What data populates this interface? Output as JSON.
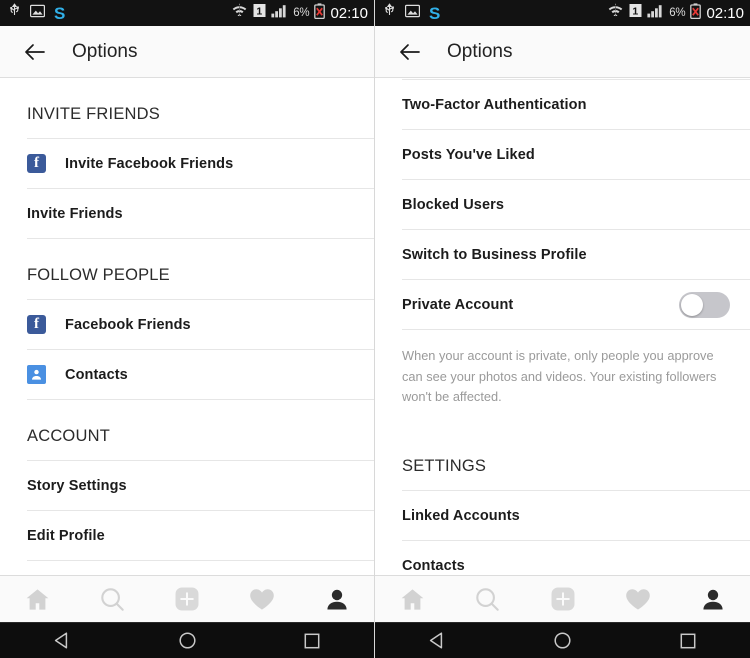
{
  "status_bar": {
    "icons": [
      "usb-icon",
      "screenshot-icon"
    ],
    "app_badge": "S",
    "wifi": "wifi-icon",
    "sim": "1",
    "signal": "signal-bars-icon",
    "battery_percent": "6%",
    "battery": "battery-error-icon",
    "time": "02:10"
  },
  "app_bar": {
    "back": "back-arrow-icon",
    "title": "Options"
  },
  "left_screen": {
    "sections": [
      {
        "header": "INVITE FRIENDS",
        "rows": [
          {
            "label": "Invite Facebook Friends",
            "icon": "facebook-icon",
            "glyph": "f"
          },
          {
            "label": "Invite Friends",
            "icon": null
          }
        ]
      },
      {
        "header": "FOLLOW PEOPLE",
        "rows": [
          {
            "label": "Facebook Friends",
            "icon": "facebook-icon",
            "glyph": "f"
          },
          {
            "label": "Contacts",
            "icon": "contacts-icon"
          }
        ]
      },
      {
        "header": "ACCOUNT",
        "rows": [
          {
            "label": "Story Settings",
            "icon": null
          },
          {
            "label": "Edit Profile",
            "icon": null
          }
        ]
      }
    ]
  },
  "right_screen": {
    "rows_top": [
      {
        "label": "Two-Factor Authentication"
      },
      {
        "label": "Posts You've Liked"
      },
      {
        "label": "Blocked Users"
      },
      {
        "label": "Switch to Business Profile"
      }
    ],
    "private_account": {
      "label": "Private Account",
      "toggle_state": "off",
      "helper_text": "When your account is private, only people you approve can see your photos and videos. Your existing followers won't be affected."
    },
    "settings_section": {
      "header": "SETTINGS",
      "rows": [
        {
          "label": "Linked Accounts"
        },
        {
          "label": "Contacts"
        }
      ]
    }
  },
  "tab_bar": {
    "tabs": [
      {
        "name": "home-icon",
        "active": false
      },
      {
        "name": "search-icon",
        "active": false
      },
      {
        "name": "add-post-icon",
        "active": false
      },
      {
        "name": "activity-heart-icon",
        "active": false
      },
      {
        "name": "profile-icon",
        "active": true
      }
    ]
  },
  "nav_bar": {
    "buttons": [
      "back-nav-icon",
      "home-nav-icon",
      "recents-nav-icon"
    ]
  },
  "colors": {
    "facebook_blue": "#3b5a9a",
    "contacts_blue": "#4a90e2",
    "toggle_off_track": "#c6c6cb",
    "accent_s": "#31b0e8"
  }
}
